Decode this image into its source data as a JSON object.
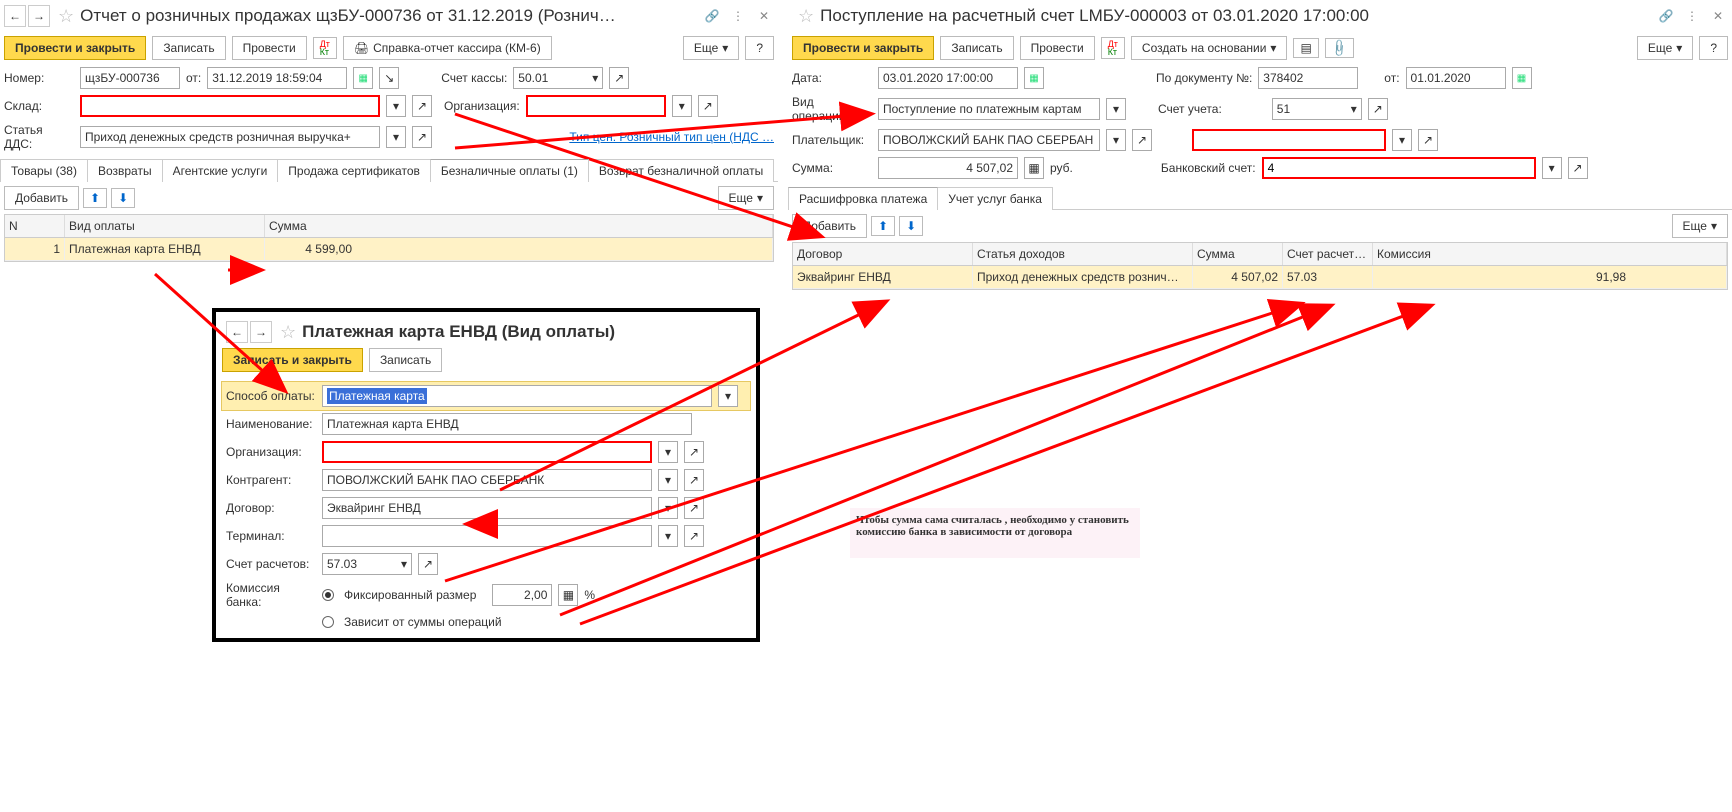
{
  "left": {
    "title": "Отчет о розничных продажах щзБУ-000736 от 31.12.2019 (Рознич…",
    "toolbar": {
      "post_close": "Провести и закрыть",
      "write": "Записать",
      "post": "Провести",
      "km6": "Справка-отчет кассира (КМ-6)",
      "more": "Еще",
      "help": "?"
    },
    "number_lbl": "Номер:",
    "number": "щзБУ-000736",
    "from_lbl": "от:",
    "date": "31.12.2019 18:59:04",
    "kassa_lbl": "Счет кассы:",
    "kassa": "50.01",
    "sklad_lbl": "Склад:",
    "org_lbl": "Организация:",
    "dds_lbl": "Статья ДДС:",
    "dds": "Приход денежных средств розничная выручка+",
    "price_link": "Тип цен: Розничный тип цен (НДС …",
    "tabs": [
      "Товары (38)",
      "Возвраты",
      "Агентские услуги",
      "Продажа сертификатов",
      "Безналичные оплаты (1)",
      "Возврат безналичной оплаты"
    ],
    "grid_tb": {
      "add": "Добавить",
      "more": "Еще"
    },
    "grid_hdr": {
      "n": "N",
      "type": "Вид оплаты",
      "sum": "Сумма"
    },
    "grid_row": {
      "n": "1",
      "type": "Платежная карта ЕНВД",
      "sum": "4 599,00"
    }
  },
  "right": {
    "title": "Поступление на расчетный счет LMБУ-000003 от 03.01.2020 17:00:00",
    "toolbar": {
      "post_close": "Провести и закрыть",
      "write": "Записать",
      "post": "Провести",
      "create": "Создать на основании",
      "more": "Еще",
      "help": "?"
    },
    "date_lbl": "Дата:",
    "date": "03.01.2020 17:00:00",
    "docno_lbl": "По документу №:",
    "docno": "378402",
    "from_lbl": "от:",
    "docdate": "01.01.2020",
    "op_lbl": "Вид операции:",
    "op": "Поступление по платежным картам",
    "acc_lbl": "Счет учета:",
    "acc": "51",
    "payer_lbl": "Плательщик:",
    "payer": "ПОВОЛЖСКИЙ БАНК ПАО СБЕРБАН",
    "sum_lbl": "Сумма:",
    "sum": "4 507,02",
    "cur": "руб.",
    "bank_lbl": "Банковский счет:",
    "bank": "4",
    "tabs": [
      "Расшифровка платежа",
      "Учет услуг банка"
    ],
    "grid_tb": {
      "add": "Добавить",
      "more": "Еще"
    },
    "grid_hdr": {
      "dog": "Договор",
      "doh": "Статья доходов",
      "sum": "Сумма",
      "acc": "Счет расчет…",
      "kom": "Комиссия"
    },
    "grid_row": {
      "dog": "Эквайринг ЕНВД",
      "doh": "Приход денежных средств рознич…",
      "sum": "4 507,02",
      "acc": "57.03",
      "kom": "91,98"
    }
  },
  "popup": {
    "title": "Платежная карта ЕНВД (Вид оплаты)",
    "toolbar": {
      "save_close": "Записать и закрыть",
      "write": "Записать"
    },
    "method_lbl": "Способ оплаты:",
    "method": "Платежная карта",
    "name_lbl": "Наименование:",
    "name": "Платежная карта ЕНВД",
    "org_lbl": "Организация:",
    "contr_lbl": "Контрагент:",
    "contr": "ПОВОЛЖСКИЙ БАНК ПАО СБЕРБАНК",
    "dog_lbl": "Договор:",
    "dog": "Эквайринг ЕНВД",
    "term_lbl": "Терминал:",
    "acc_lbl": "Счет расчетов:",
    "acc": "57.03",
    "kom_lbl": "Комиссия банка:",
    "r1": "Фиксированный размер",
    "kom": "2,00",
    "pct": "%",
    "r2": "Зависит от суммы операций"
  },
  "note": "Чтобы сумма сама считалась , необходимо у становить комиссию банка в зависимости от договора"
}
